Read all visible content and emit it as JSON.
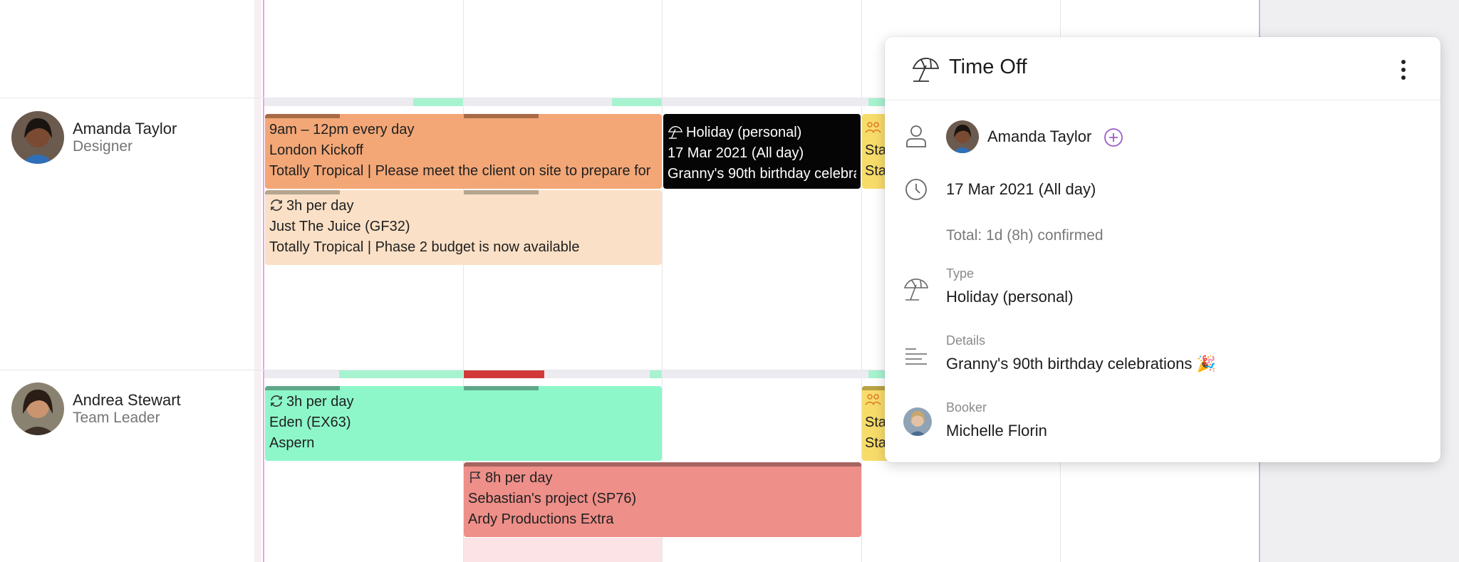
{
  "people": [
    {
      "name": "Amanda Taylor",
      "role": "Designer"
    },
    {
      "name": "Andrea Stewart",
      "role": "Team Leader"
    }
  ],
  "bookings": {
    "amanda_london": {
      "line1": "9am – 12pm every day",
      "line2": "London Kickoff",
      "line3": "Totally Tropical | Please meet the client on site to prepare for"
    },
    "amanda_juice": {
      "line1": "3h per day",
      "line2": "Just The Juice (GF32)",
      "line3": "Totally Tropical | Phase 2 budget is now available"
    },
    "amanda_holiday": {
      "line1": "Holiday (personal)",
      "line2": "17 Mar 2021 (All day)",
      "line3": "Granny's 90th birthday celebrations"
    },
    "amanda_sta": {
      "line1": "Sta",
      "line2": "Sta"
    },
    "andrea_eden": {
      "line1": "3h per day",
      "line2": "Eden (EX63)",
      "line3": "Aspern"
    },
    "andrea_sebastian": {
      "line1": "8h per day",
      "line2": "Sebastian's project (SP76)",
      "line3": "Ardy Productions Extra"
    },
    "andrea_sta": {
      "line1": "Sta",
      "line2": "Sta"
    }
  },
  "popup": {
    "title": "Time Off",
    "person": "Amanda Taylor",
    "date": "17 Mar 2021 (All day)",
    "total": "Total: 1d (8h) confirmed",
    "type_label": "Type",
    "type_value": "Holiday (personal)",
    "details_label": "Details",
    "details_value": "Granny's 90th birthday celebrations 🎉",
    "booker_label": "Booker",
    "booker_value": "Michelle Florin"
  },
  "colors": {
    "orange_booking": "#f3a777",
    "peach_booking": "#fae0c6",
    "green_booking": "#8df7c9",
    "red_booking": "#ee8f89",
    "black_booking": "#050505",
    "yellow_booking": "#f8dc6a",
    "accent_purple": "#9b5dc9",
    "availability_green": "#a7f3d0",
    "overbooked_red": "#d23a3a"
  }
}
